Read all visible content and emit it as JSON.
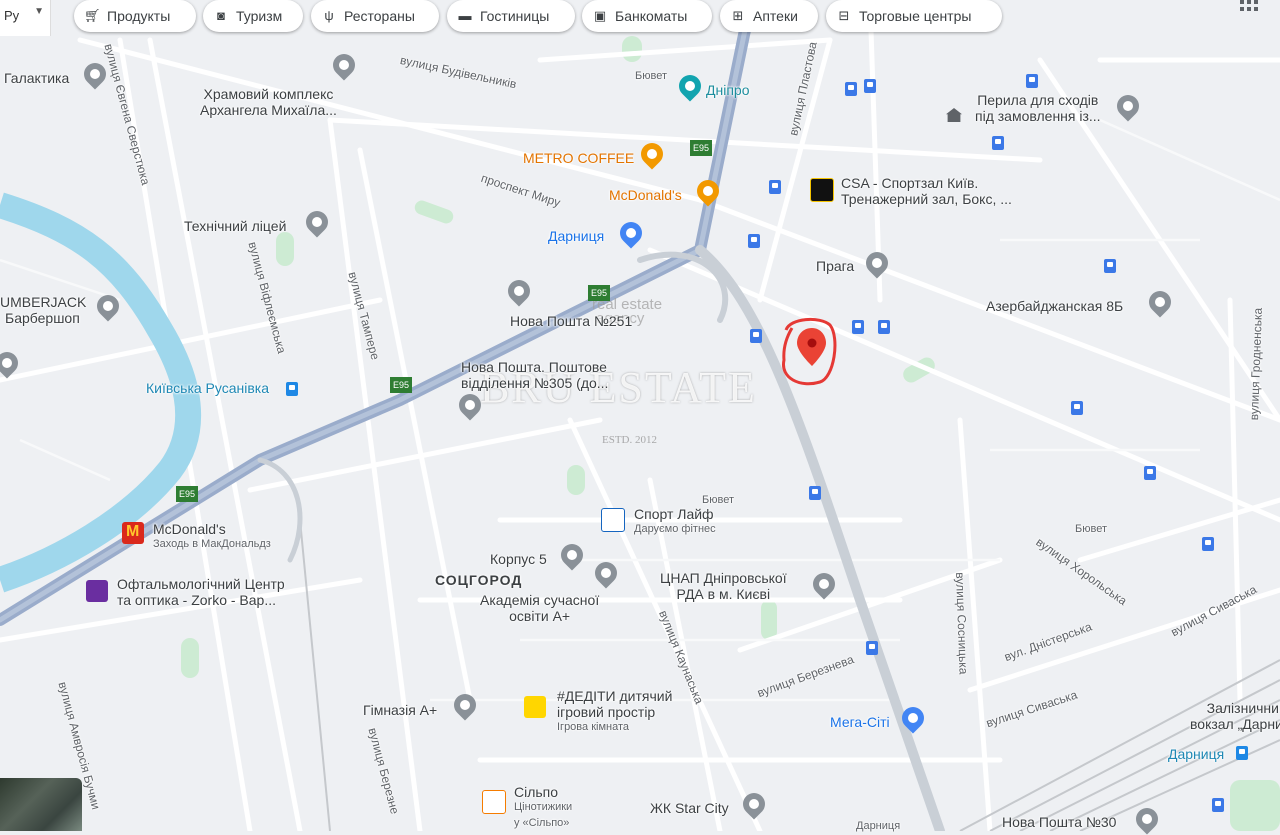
{
  "toolbar": {
    "language": "Ру",
    "chips": [
      {
        "label": "Продукты",
        "icon": "cart-icon"
      },
      {
        "label": "Туризм",
        "icon": "camera-icon"
      },
      {
        "label": "Рестораны",
        "icon": "restaurant-icon"
      },
      {
        "label": "Гостиницы",
        "icon": "bed-icon"
      },
      {
        "label": "Банкоматы",
        "icon": "atm-icon"
      },
      {
        "label": "Аптеки",
        "icon": "pharmacy-icon"
      },
      {
        "label": "Торговые центры",
        "icon": "shopping-icon"
      }
    ]
  },
  "places": {
    "galaktika": "Галактика",
    "church_1": "Храмовий комплекс",
    "church_2": "Архангела Михаїла...",
    "dnipro": "Дніпро",
    "byuvet_top": "Бювет",
    "metro_coffee": "METRO COFFEE",
    "mcdonalds_top": "McDonald's",
    "darnytsia": "Дарниця",
    "tech_lyceum": "Технічний ліцей",
    "lumberjack_1": "UMBERJACK",
    "lumberjack_2": "Барбершоп",
    "rusanivka": "Київська Русанівка",
    "nova_poshta_251": "Нова Пошта №251",
    "nova_poshta_305_1": "Нова Пошта. Поштове",
    "nova_poshta_305_2": "відділення №305 (до...",
    "perila_1": "Перила для сходів",
    "perila_2": "під замовлення із...",
    "csa_1": "CSA - Спортзал Київ.",
    "csa_2": "Тренажерний зал, Бокс, ...",
    "praha": "Прага",
    "azerb": "Азербайджанская 8Б",
    "mcdonalds_left": "McDonald's",
    "mcdonalds_left_sub": "Заходь в МакДональдз",
    "oftalm_1": "Офтальмологічний Центр",
    "oftalm_2": "та оптика - Zorko - Вар...",
    "sport_life": "Спорт Лайф",
    "sport_life_sub": "Даруємо фітнес",
    "byuvet_mid": "Бювет",
    "byuvet_right": "Бювет",
    "korpus5": "Корпус 5",
    "sotsgorod": "СОЦГОРОД",
    "academy_1": "Академія сучасної",
    "academy_2": "освіти А+",
    "cnap_1": "ЦНАП Дніпровської",
    "cnap_2": "РДА в м. Києві",
    "gymnasium": "Гімназія А+",
    "dediti_1": "#ДЕДІТИ дитячий",
    "dediti_2": "ігровий простір",
    "dediti_sub": "Ігрова кімната",
    "silpo": "Сільпо",
    "silpo_sub_1": "Цінотижики",
    "silpo_sub_2": "у «Сільпо»",
    "megacity": "Мега-Сіті",
    "star_city": "ЖК Star City",
    "darnytsia_bottom": "Дарниця",
    "darnytsia_station": "Дарниця",
    "vokzal_1": "Залізничний",
    "vokzal_2": "вокзал „Дарниця\"",
    "nova_poshta_30": "Нова Пошта №30"
  },
  "streets": {
    "sverstiuka": "вулиця Євгена Сверстюка",
    "budivelnykiv": "вулиця Будівельників",
    "myru": "проспект Миру",
    "plastova": "вулиця Пластова",
    "vifleiemska": "вулиця Віфлеємська",
    "tampere": "вулиця Тампере",
    "kaunaska": "вулиця Каунаська",
    "berezneva": "вулиця Березнева",
    "berezneva_2": "вулиця Березне",
    "sosnytska": "вулиця Сосницька",
    "dnisterska": "вул. Дністерська",
    "syvaska": "вулиця Сиваська",
    "syvaska_2": "вулиця Сиваська",
    "khorolska": "вулиця Хорольська",
    "hrodnenska": "вулиця Гродненська",
    "ambrosiia": "вулиця Амвросія Бучми"
  },
  "roads": {
    "e95": "E95"
  },
  "watermark": {
    "brand": "BRU ESTATE",
    "estd": "ESTD. 2012",
    "agency_1": "real estate",
    "agency_2": "agency"
  },
  "colors": {
    "water": "#9fd7ec",
    "highway": "#8fa4c4",
    "target_circle": "#e53935",
    "target_pin": "#ea4335"
  }
}
